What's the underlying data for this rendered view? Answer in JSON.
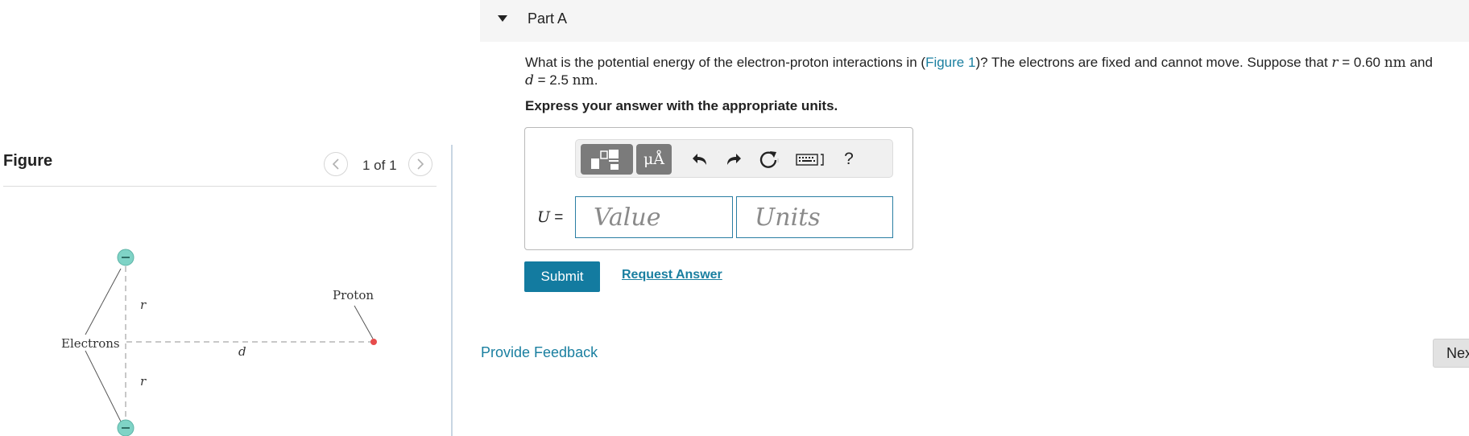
{
  "figure": {
    "title": "Figure",
    "counter": "1 of 1",
    "prev_icon": "chevron-left-icon",
    "next_icon": "chevron-right-icon",
    "diagram": {
      "electrons_label": "Electrons",
      "proton_label": "Proton",
      "r_label": "r",
      "d_label": "d",
      "electron_color": "#7fd3c6",
      "proton_color": "#e74c4c"
    }
  },
  "part": {
    "toggle_icon": "caret-down-icon",
    "title": "Part A"
  },
  "question": {
    "text_before_link": "What is the potential energy of the electron-proton interactions in (",
    "link_text": "Figure 1",
    "text_after_link": ")? The electrons are fixed and cannot move. Suppose that ",
    "r_symbol": "r",
    "r_value": " = 0.60 ",
    "r_unit": "nm",
    "and_text": " and",
    "d_symbol": "d",
    "d_value": " = 2.5 ",
    "d_unit": "nm",
    "period": "."
  },
  "instruction": "Express your answer with the appropriate units.",
  "answer": {
    "toolbar": {
      "template_icon": "templates-icon",
      "units_label": "μÅ",
      "undo_icon": "undo-icon",
      "redo_icon": "redo-icon",
      "reset_icon": "reset-icon",
      "keyboard_icon": "keyboard-icon",
      "help_label": "?"
    },
    "variable": "U",
    "equals": " =",
    "value_placeholder": "Value",
    "units_placeholder": "Units"
  },
  "actions": {
    "submit": "Submit",
    "request_answer": "Request Answer",
    "provide_feedback": "Provide Feedback",
    "next": "Next"
  },
  "colors": {
    "accent": "#137ba0",
    "link": "#1a7fa0"
  }
}
